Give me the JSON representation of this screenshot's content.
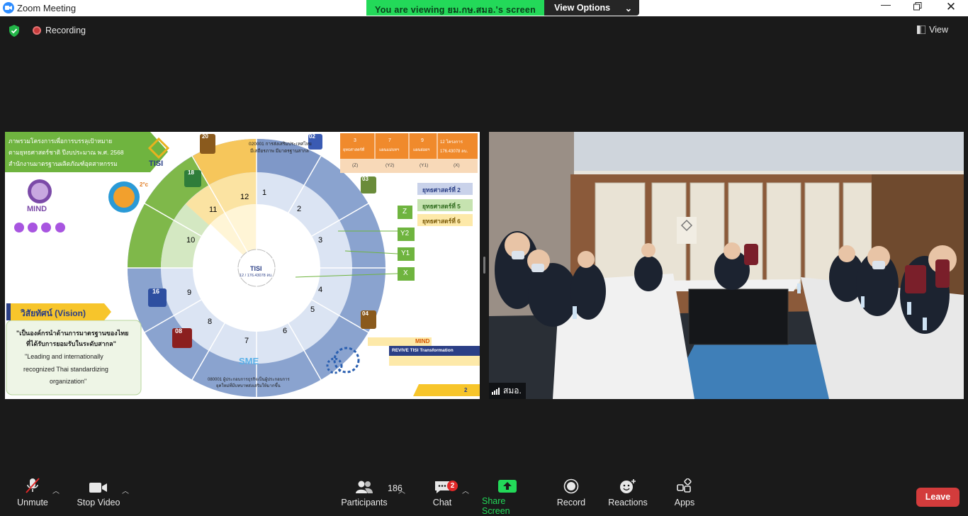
{
  "window": {
    "title": "Zoom Meeting"
  },
  "banner": {
    "message": "You are viewing ยม.กษ.สมอ.'s screen",
    "view_options": "View Options"
  },
  "topbar": {
    "recording": "Recording",
    "view": "View"
  },
  "slide": {
    "heading_line1": "ภาพรวมโครงการเพื่อการบรรลุเป้าหมาย",
    "heading_line2": "ตามยุทธศาสตร์ชาติ ปีงบประมาณ พ.ศ. 2568",
    "heading_line3": "สำนักงานมาตรฐานผลิตภัณฑ์อุตสาหกรรม",
    "logo_text": "TISI",
    "mind": "MIND",
    "temp": "2°c",
    "stats": [
      {
        "num": "3",
        "label": "ยุทธศาสตร์ที่",
        "code": "(Z)"
      },
      {
        "num": "7",
        "label": "แผนแม่บทฯ",
        "code": "(Y2)"
      },
      {
        "num": "9",
        "label": "แผนย่อยฯ",
        "code": "(Y1)"
      },
      {
        "num": "12 โครงการ",
        "label": "176.43078 ลบ.",
        "code": "(X)"
      }
    ],
    "strategies": [
      "ยุทธศาสตร์ที่ 2",
      "ยุทธศาสตร์ที่ 5",
      "ยุทธศาสตร์ที่ 6"
    ],
    "levels": [
      "Z",
      "Y2",
      "Y1",
      "X"
    ],
    "center_top": "TISI",
    "center_label": "12 / 176.43078 ลบ.",
    "segment_numbers": [
      "1",
      "2",
      "3",
      "4",
      "5",
      "6",
      "7",
      "8",
      "9",
      "10",
      "11",
      "12"
    ],
    "badges": [
      "02",
      "03",
      "04",
      "08",
      "16",
      "18",
      "20"
    ],
    "vision_title": "วิสัยทัศน์ (Vision)",
    "vision_th_1": "\"เป็นองค์กรนำด้านการมาตรฐานของไทย",
    "vision_th_2": "ที่ได้รับการยอมรับในระดับสากล\"",
    "vision_en_1": "\"Leading and internationally",
    "vision_en_2": "recognized Thai standardizing",
    "vision_en_3": "organization\"",
    "mind_tag": "MIND",
    "revive": "REVIVE TISI Transformation",
    "page_no": "2",
    "code_center": "020001 การส่งเสริมประเทศไทย",
    "code_center2": "มีเสถียรภาพ มีมาตรฐานสากล",
    "code_bottom": "080001 ผู้ประกอบการธุรกิจเป็นผู้ประกอบการ",
    "code_bottom2": "ยุคใหม่ที่มีบทบาทส่งเสริมให้มากขึ้น",
    "sme": "SME"
  },
  "video": {
    "participant_name": "สมอ.",
    "sign": "TISI"
  },
  "toolbar": {
    "unmute": "Unmute",
    "stop_video": "Stop Video",
    "participants": "Participants",
    "participants_count": "186",
    "chat": "Chat",
    "chat_badge": "2",
    "share_screen": "Share Screen",
    "record": "Record",
    "reactions": "Reactions",
    "apps": "Apps",
    "leave": "Leave"
  },
  "colors": {
    "zoom_blue": "#2d8cff",
    "banner_green": "#23d959",
    "leave_red": "#d33c3c",
    "share_green": "#23d959"
  }
}
